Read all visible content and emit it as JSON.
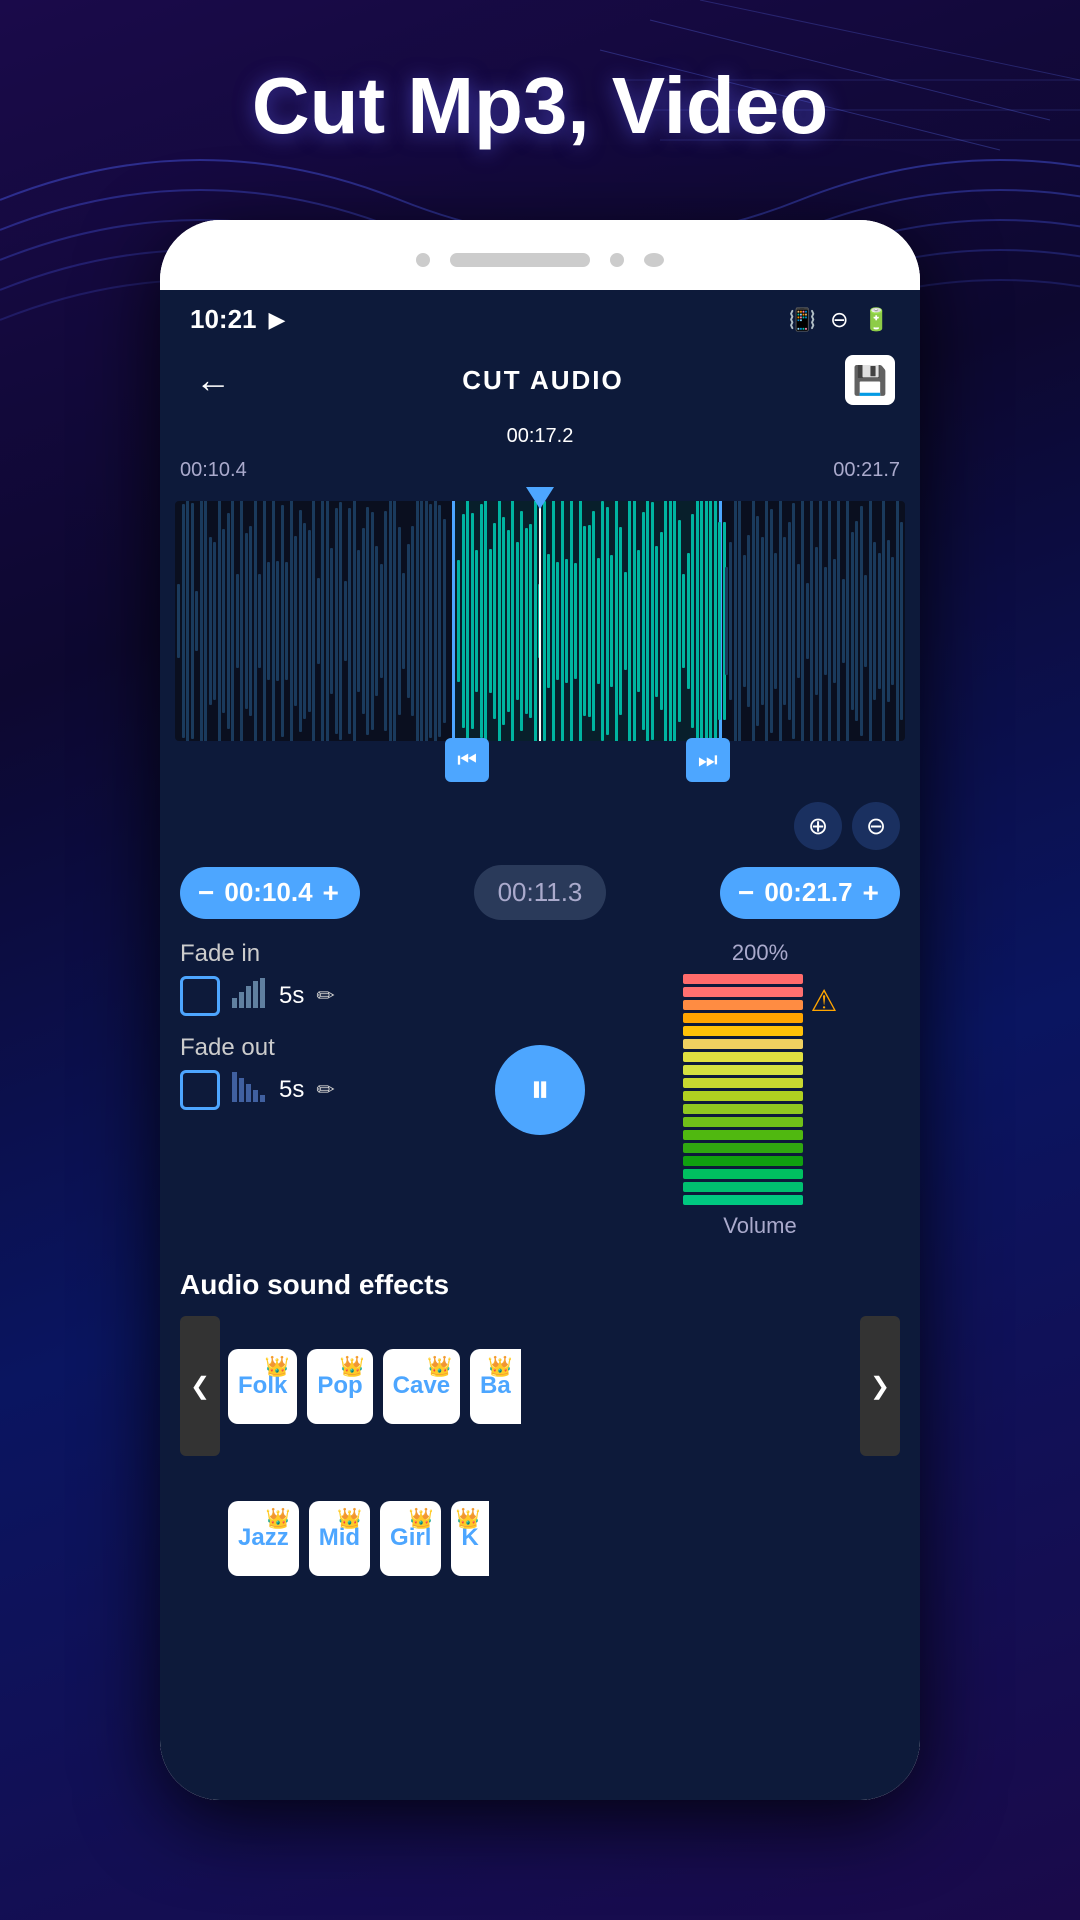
{
  "page": {
    "title": "Cut Mp3, Video"
  },
  "statusBar": {
    "time": "10:21",
    "icons": [
      "vibrate",
      "minus-circle",
      "battery"
    ]
  },
  "appBar": {
    "title": "CUT AUDIO",
    "backLabel": "←",
    "saveIcon": "💾"
  },
  "waveform": {
    "playheadTime": "00:17.2",
    "leftMarker": "00:10.4",
    "rightMarker": "00:21.7"
  },
  "timeControls": {
    "startMinus": "−",
    "startTime": "00:10.4",
    "startPlus": "+",
    "duration": "00:11.3",
    "endMinus": "−",
    "endTime": "00:21.7",
    "endPlus": "+"
  },
  "zoom": {
    "inIcon": "⊕",
    "outIcon": "⊖"
  },
  "fade": {
    "inLabel": "Fade in",
    "inDuration": "5s",
    "outLabel": "Fade out",
    "outDuration": "5s"
  },
  "playback": {
    "icon": "⏸"
  },
  "volume": {
    "percent": "200%",
    "label": "Volume",
    "warningIcon": "⚠",
    "bars": [
      {
        "color": "#ff6b6b"
      },
      {
        "color": "#ff7070"
      },
      {
        "color": "#ff8c42"
      },
      {
        "color": "#ffa500"
      },
      {
        "color": "#ffc107"
      },
      {
        "color": "#f0d060"
      },
      {
        "color": "#e0e040"
      },
      {
        "color": "#d4e040"
      },
      {
        "color": "#c8d830"
      },
      {
        "color": "#b0d020"
      },
      {
        "color": "#90c820"
      },
      {
        "color": "#70c018"
      },
      {
        "color": "#50b810"
      },
      {
        "color": "#30a810"
      },
      {
        "color": "#10a010"
      },
      {
        "color": "#00c060"
      },
      {
        "color": "#00c070"
      },
      {
        "color": "#00c880"
      }
    ]
  },
  "soundEffects": {
    "sectionTitle": "Audio sound effects",
    "leftArrow": "❮",
    "rightArrow": "❯",
    "row1": [
      {
        "label": "Folk",
        "crown": "👑"
      },
      {
        "label": "Pop",
        "crown": "👑"
      },
      {
        "label": "Cave",
        "crown": "👑"
      },
      {
        "label": "Ba",
        "crown": "👑",
        "partial": true
      }
    ],
    "row2": [
      {
        "label": "Jazz",
        "crown": "👑"
      },
      {
        "label": "Mid",
        "crown": "👑"
      },
      {
        "label": "Girl",
        "crown": "👑"
      },
      {
        "label": "K",
        "crown": "👑",
        "partial": true
      }
    ]
  }
}
